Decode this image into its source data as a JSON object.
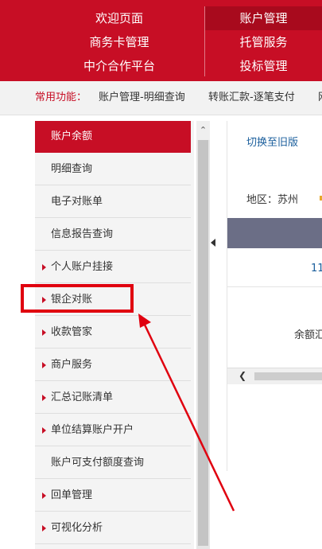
{
  "topnav": {
    "items": [
      {
        "label": "欢迎页面"
      },
      {
        "label": "账户管理"
      },
      {
        "label": "商务卡管理"
      },
      {
        "label": "托管服务"
      },
      {
        "label": "中介合作平台"
      },
      {
        "label": "投标管理"
      }
    ],
    "active_index": 1
  },
  "common": {
    "label": "常用功能：",
    "links": [
      "账户管理-明细查询",
      "转账汇款-逐笔支付",
      "网"
    ]
  },
  "sidebar": {
    "items": [
      {
        "label": "账户余额",
        "active": true,
        "arrow": false
      },
      {
        "label": "明细查询",
        "active": false,
        "arrow": false
      },
      {
        "label": "电子对账单",
        "active": false,
        "arrow": false
      },
      {
        "label": "信息报告查询",
        "active": false,
        "arrow": false
      },
      {
        "label": "个人账户挂接",
        "active": false,
        "arrow": true
      },
      {
        "label": "银企对账",
        "active": false,
        "arrow": true
      },
      {
        "label": "收款管家",
        "active": false,
        "arrow": true
      },
      {
        "label": "商户服务",
        "active": false,
        "arrow": true
      },
      {
        "label": "汇总记账清单",
        "active": false,
        "arrow": true
      },
      {
        "label": "单位结算账户开户",
        "active": false,
        "arrow": true
      },
      {
        "label": "账户可支付额度查询",
        "active": false,
        "arrow": false
      },
      {
        "label": "回单管理",
        "active": false,
        "arrow": true
      },
      {
        "label": "可视化分析",
        "active": false,
        "arrow": true
      }
    ]
  },
  "main": {
    "switch_label": "切换至旧版",
    "region_label": "地区：苏州",
    "number": "11",
    "balance_label": "余额汇"
  },
  "icons": {
    "scroll_up": "chevron-up-icon",
    "scroll_left": "chevron-left-icon",
    "collapse": "caret-left-icon",
    "menu_arrow": "caret-right-icon"
  },
  "colors": {
    "brand_red": "#c70e25",
    "active_nav": "#a80a1d",
    "link_blue": "#1a5e9c",
    "header_gray": "#6b6e86",
    "annotation_red": "#e0000f"
  }
}
